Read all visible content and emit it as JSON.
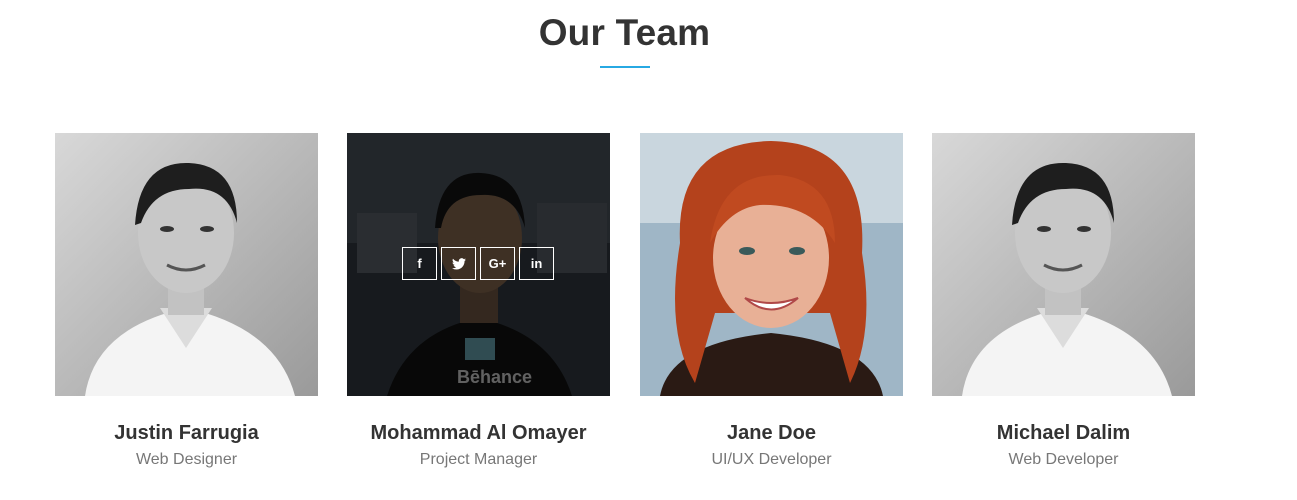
{
  "section": {
    "title": "Our Team",
    "accent_color": "#27a9e3"
  },
  "members": [
    {
      "name": "Justin Farrugia",
      "role": "Web Designer",
      "photo": "bw-portrait-man"
    },
    {
      "name": "Mohammad Al Omayer",
      "role": "Project Manager",
      "photo": "portrait-man-behance-shirt",
      "hovered": true,
      "social": [
        {
          "icon": "facebook-icon",
          "glyph": "f"
        },
        {
          "icon": "twitter-icon",
          "glyph": "t"
        },
        {
          "icon": "google-plus-icon",
          "glyph": "G+"
        },
        {
          "icon": "linkedin-icon",
          "glyph": "in"
        }
      ]
    },
    {
      "name": "Jane Doe",
      "role": "UI/UX Developer",
      "photo": "portrait-woman-red-hair"
    },
    {
      "name": "Michael Dalim",
      "role": "Web Developer",
      "photo": "bw-portrait-man"
    }
  ]
}
